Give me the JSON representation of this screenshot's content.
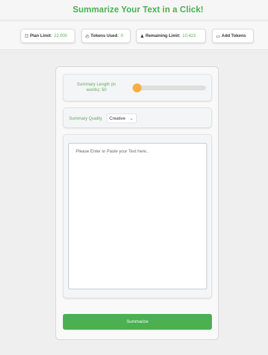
{
  "header": {
    "title": "Summarize Your Text in a Click!"
  },
  "stats": {
    "plan_limit": {
      "icon": "grid-icon",
      "label": "Plan Limit:",
      "value": "22,000"
    },
    "tokens_used": {
      "icon": "clock-icon",
      "label": "Tokens Used:",
      "value": "0"
    },
    "remaining_limit": {
      "icon": "group-icon",
      "label": "Remaining Limit:",
      "value": "10,423"
    },
    "add_tokens": {
      "icon": "ticket-icon",
      "label": "Add Tokens"
    }
  },
  "form": {
    "summary_length": {
      "label": "Summary Length (in words):",
      "value": "50",
      "min": 50,
      "max": 1000,
      "accent": "#f7ad45"
    },
    "summary_quality": {
      "label": "Summary Quality",
      "selected": "Creative"
    },
    "text_input": {
      "placeholder": "Please Enter or Paste your Text here.."
    },
    "submit_label": "Summarize"
  },
  "colors": {
    "brand": "#4caf50",
    "slider_thumb": "#f7ad45"
  }
}
